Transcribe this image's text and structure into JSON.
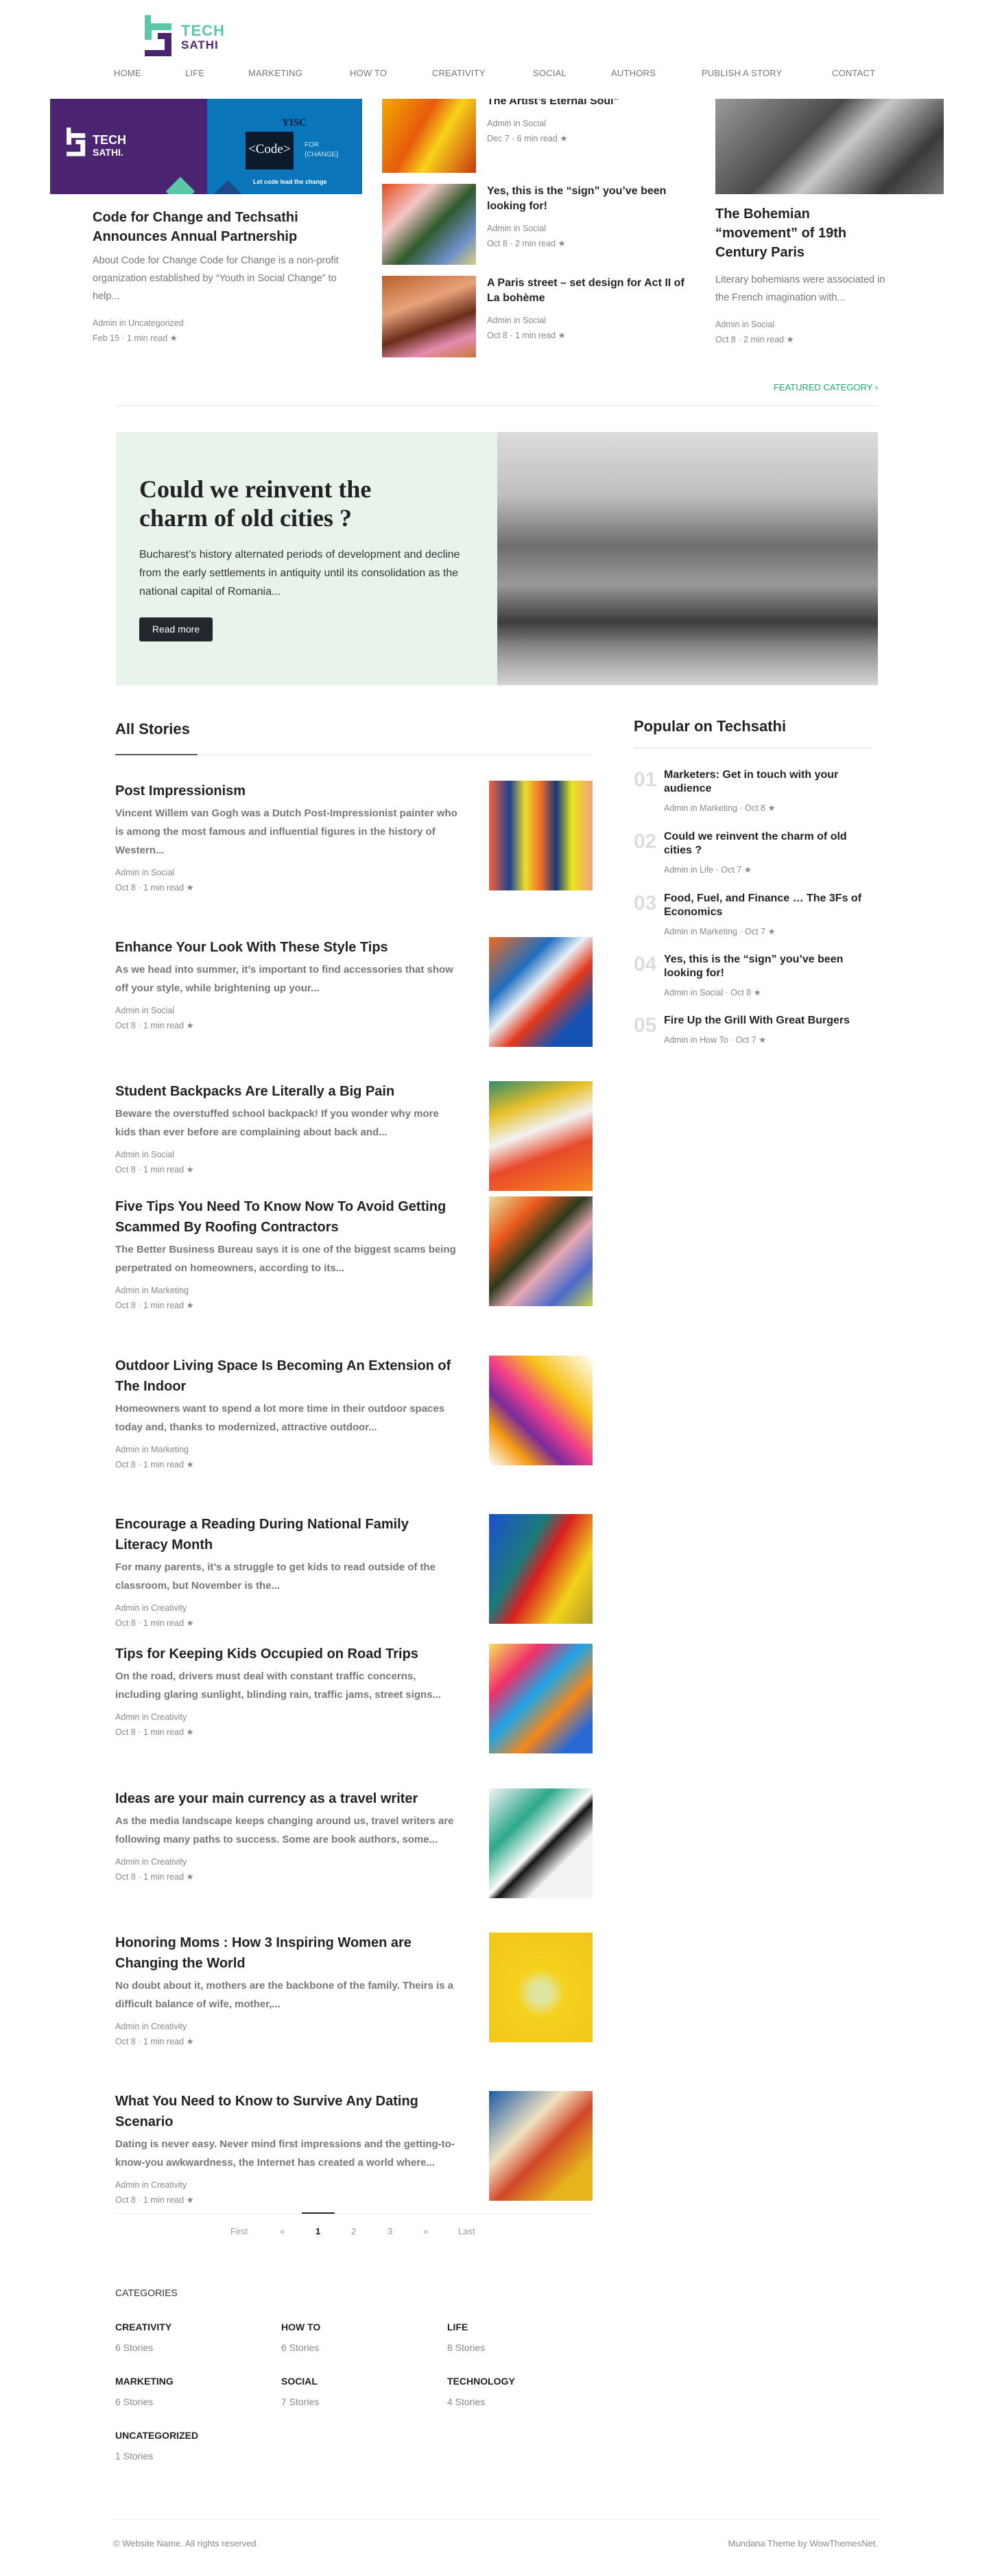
{
  "header": {
    "logo": {
      "text_top": "TECH",
      "text_bottom": "SATHI"
    },
    "nav": [
      "HOME",
      "LIFE",
      "MARKETING",
      "HOW TO",
      "CREATIVITY",
      "SOCIAL",
      "AUTHORS",
      "PUBLISH A STORY",
      "CONTACT"
    ]
  },
  "colors": {
    "teal": "#5cc6a8",
    "purple": "#4a2470",
    "blue": "#0a75b8",
    "accent_green": "#1aaa6e",
    "hero_bg": "#e8f3ec",
    "button_dark": "#23272b"
  },
  "featured": {
    "left": {
      "image_text": {
        "brand_top": "TECH",
        "brand_bottom": "SATHI.",
        "yisc": "YISC",
        "code": "<Code>",
        "for": "FOR",
        "change": "{CHANGE}",
        "tagline": "Let code lead the change"
      },
      "title": "Code for Change and Techsathi Announces Annual Partnership",
      "excerpt": "About Code for Change Code for Change is a non-profit organization established by “Youth in Social Change” to help...",
      "author_line": "Admin in Uncategorized",
      "date_line": "Feb 15 · 1 min read"
    },
    "middle": [
      {
        "title": "Museums are a “Permanent Place For The Artist’s Eternal Soul”",
        "author_line": "Admin in Social",
        "date_line": "Dec 7 · 6 min read"
      },
      {
        "title": "Yes, this is the “sign” you’ve been looking for!",
        "author_line": "Admin in Social",
        "date_line": "Oct 8 · 2 min read"
      },
      {
        "title": "A Paris street – set design for Act II of La bohème",
        "author_line": "Admin in Social",
        "date_line": "Oct 8 · 1 min read"
      }
    ],
    "right": {
      "title": "The Bohemian “movement” of 19th Century Paris",
      "excerpt": "Literary bohemians were associated in the French imagination with...",
      "author_line": "Admin in Social",
      "date_line": "Oct 8 · 2 min read"
    },
    "link": "FEATURED CATEGORY ›"
  },
  "hero": {
    "title": "Could we reinvent the charm of old cities ?",
    "excerpt": "Bucharest’s history alternated periods of development and decline from the early settlements in antiquity until its consolidation as the national capital of Romania...",
    "button": "Read more"
  },
  "all_stories": {
    "heading": "All Stories",
    "items": [
      {
        "title": "Post Impressionism",
        "excerpt": "Vincent Willem van Gogh was a Dutch Post-Impressionist painter who is among the most famous and influential figures in the history of Western...",
        "author_line": "Admin in Social",
        "date_line": "Oct 8 · 1 min read"
      },
      {
        "title": "Enhance Your Look With These Style Tips",
        "excerpt": "As we head into summer, it’s important to find accessories that show off your style, while brightening up your...",
        "author_line": "Admin in Social",
        "date_line": "Oct 8 · 1 min read"
      },
      {
        "title": "Student Backpacks Are Literally a Big Pain",
        "excerpt": "Beware the overstuffed school backpack! If you wonder why more kids than ever before are complaining about back and...",
        "author_line": "Admin in Social",
        "date_line": "Oct 8 · 1 min read"
      },
      {
        "title": "Five Tips You Need To Know Now To Avoid Getting Scammed By Roofing Contractors",
        "excerpt": "The Better Business Bureau says it is one of the biggest scams being perpetrated on homeowners, according to its...",
        "author_line": "Admin in Marketing",
        "date_line": "Oct 8 · 1 min read"
      },
      {
        "title": "Outdoor Living Space Is Becoming An Extension of The Indoor",
        "excerpt": "Homeowners want to spend a lot more time in their outdoor spaces today and, thanks to modernized, attractive outdoor...",
        "author_line": "Admin in Marketing",
        "date_line": "Oct 8 · 1 min read"
      },
      {
        "title": "Encourage a Reading During National Family Literacy Month",
        "excerpt": "For many parents, it’s a struggle to get kids to read outside of the classroom, but November is the...",
        "author_line": "Admin in Creativity",
        "date_line": "Oct 8 · 1 min read"
      },
      {
        "title": "Tips for Keeping Kids Occupied on Road Trips",
        "excerpt": "On the road, drivers must deal with constant traffic concerns, including glaring sunlight, blinding rain, traffic jams, street signs...",
        "author_line": "Admin in Creativity",
        "date_line": "Oct 8 · 1 min read"
      },
      {
        "title": "Ideas are your main currency as a travel writer",
        "excerpt": "As the media landscape keeps changing around us, travel writers are following many paths to success. Some are book authors, some...",
        "author_line": "Admin in Creativity",
        "date_line": "Oct 8 · 1 min read"
      },
      {
        "title": "Honoring Moms : How 3 Inspiring Women are Changing the World",
        "excerpt": "No doubt about it, mothers are the backbone of the family. Theirs is a difficult balance of wife, mother,...",
        "author_line": "Admin in Creativity",
        "date_line": "Oct 8 · 1 min read"
      },
      {
        "title": "What You Need to Know to Survive Any Dating Scenario",
        "excerpt": "Dating is never easy. Never mind first impressions and the getting-to-know-you awkwardness, the Internet has created a world where...",
        "author_line": "Admin in Creativity",
        "date_line": "Oct 8 · 1 min read"
      }
    ]
  },
  "popular": {
    "heading": "Popular on Techsathi",
    "items": [
      {
        "num": "01",
        "title": "Marketers: Get in touch with your audience",
        "meta": "Admin in Marketing · Oct 8"
      },
      {
        "num": "02",
        "title": "Could we reinvent the charm of old cities ?",
        "meta": "Admin in Life · Oct 7"
      },
      {
        "num": "03",
        "title": "Food, Fuel, and Finance … The 3Fs of Economics",
        "meta": "Admin in Marketing · Oct 7"
      },
      {
        "num": "04",
        "title": "Yes, this is the “sign” you’ve been looking for!",
        "meta": "Admin in Social · Oct 8"
      },
      {
        "num": "05",
        "title": "Fire Up the Grill With Great Burgers",
        "meta": "Admin in How To · Oct 7"
      }
    ]
  },
  "pagination": {
    "items": [
      "First",
      "«",
      "1",
      "2",
      "3",
      "»",
      "Last"
    ],
    "current": "1"
  },
  "categories": {
    "heading": "CATEGORIES",
    "items": [
      {
        "name": "CREATIVITY",
        "count": "6 Stories"
      },
      {
        "name": "HOW TO",
        "count": "6 Stories"
      },
      {
        "name": "LIFE",
        "count": "8 Stories"
      },
      {
        "name": "MARKETING",
        "count": "6 Stories"
      },
      {
        "name": "SOCIAL",
        "count": "7 Stories"
      },
      {
        "name": "TECHNOLOGY",
        "count": "4 Stories"
      },
      {
        "name": "UNCATEGORIZED",
        "count": "1 Stories"
      }
    ]
  },
  "footer": {
    "left": "© Website Name. All rights reserved.",
    "right": "Mundana Theme by WowThemesNet."
  },
  "icons": {
    "star": "star-icon"
  }
}
